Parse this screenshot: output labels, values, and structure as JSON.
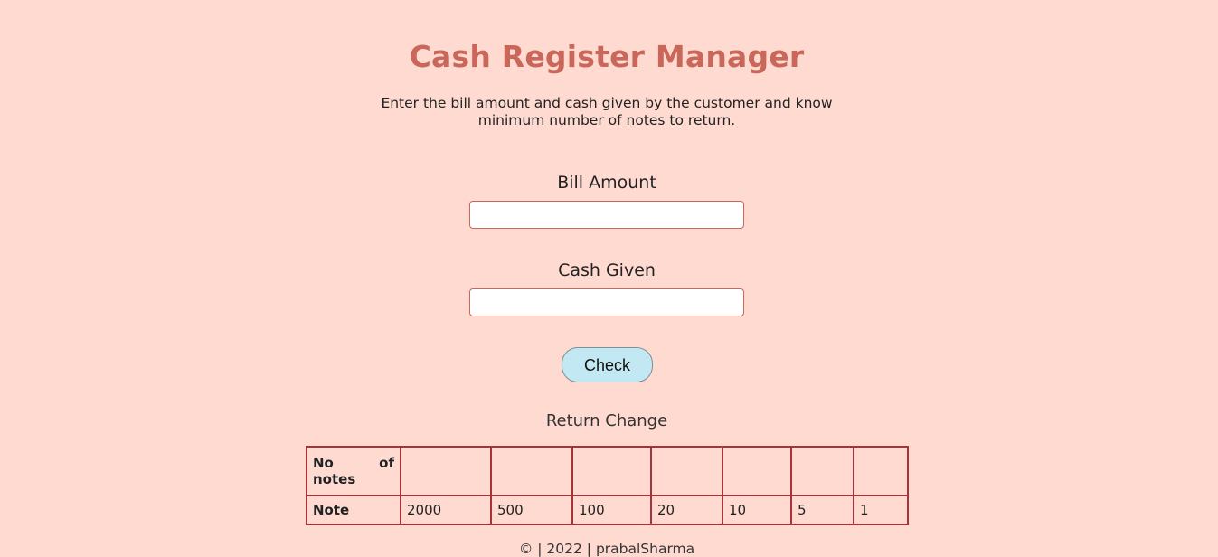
{
  "header": {
    "title": "Cash Register Manager",
    "description": "Enter the bill amount and cash given by the customer and know minimum number of notes to return."
  },
  "form": {
    "bill_label": "Bill Amount",
    "bill_value": "",
    "cash_label": "Cash Given",
    "cash_value": "",
    "check_label": "Check"
  },
  "result": {
    "heading": "Return Change",
    "row_headers": [
      "No of notes",
      "Note"
    ],
    "notes_counts": [
      "",
      "",
      "",
      "",
      "",
      "",
      ""
    ],
    "denominations": [
      "2000",
      "500",
      "100",
      "20",
      "10",
      "5",
      "1"
    ]
  },
  "footer": {
    "text": "© | 2022 | prabalSharma"
  },
  "colors": {
    "background": "#FFDAD1",
    "title": "#C9685A",
    "table_border": "#A8313A",
    "button": "#C2E9F3"
  }
}
